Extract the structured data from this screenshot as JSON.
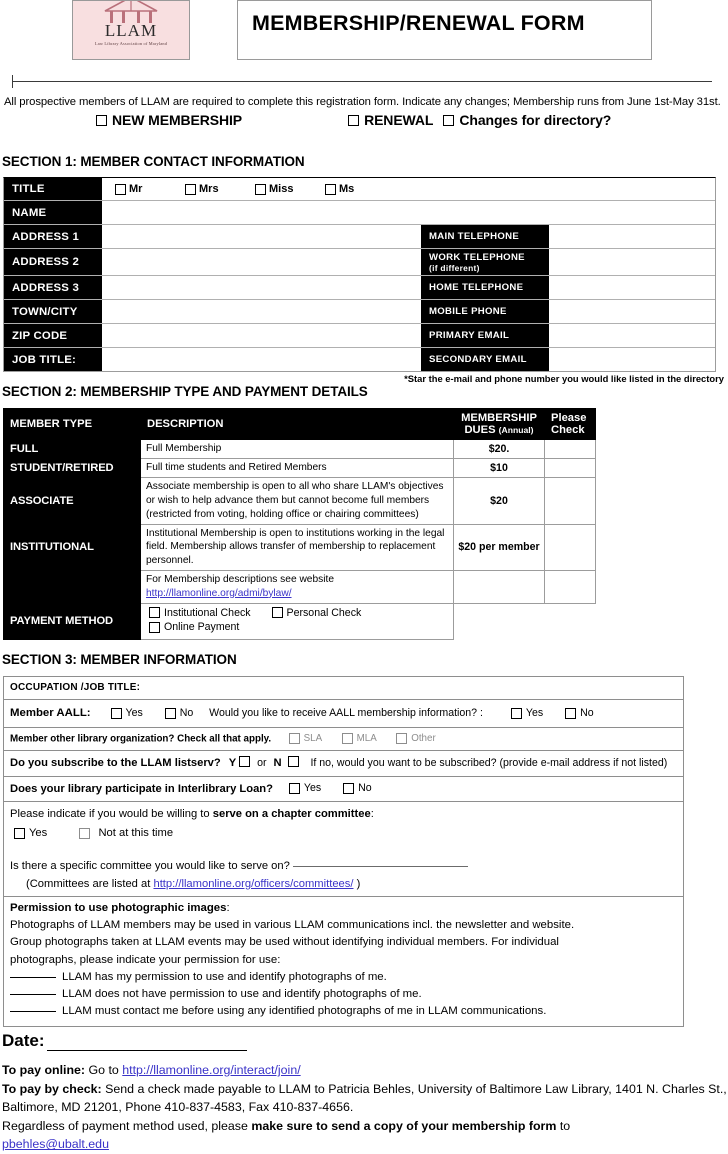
{
  "header": {
    "logo": {
      "word": "LLAM",
      "subtitle": "Law Library Association of Maryland"
    },
    "title": "MEMBERSHIP/RENEWAL FORM"
  },
  "intro": {
    "paragraph": "All prospective members of LLAM are required to complete this registration form. Indicate any changes; Membership runs from June 1st-May 31st.",
    "options": [
      "NEW MEMBERSHIP",
      "RENEWAL",
      "Changes for directory?"
    ]
  },
  "section1": {
    "heading": "SECTION 1: MEMBER CONTACT INFORMATION",
    "title_row_label": "TITLE",
    "title_options": [
      "Mr",
      "Mrs",
      "Miss",
      "Ms"
    ],
    "left_labels": [
      "NAME",
      "ADDRESS 1",
      "ADDRESS 2",
      "ADDRESS 3",
      "TOWN/CITY",
      "ZIP CODE",
      "JOB TITLE:"
    ],
    "right_labels": [
      {
        "main": "MAIN TELEPHONE",
        "sub": ""
      },
      {
        "main": "WORK TELEPHONE",
        "sub": "(if different)"
      },
      {
        "main": "HOME TELEPHONE",
        "sub": ""
      },
      {
        "main": "MOBILE PHONE",
        "sub": ""
      },
      {
        "main": "PRIMARY EMAIL",
        "sub": ""
      },
      {
        "main": "SECONDARY EMAIL",
        "sub": ""
      }
    ],
    "star_note": "*Star the e-mail and phone number you would like listed in the directory"
  },
  "section2": {
    "heading": "SECTION 2: MEMBERSHIP TYPE AND PAYMENT DETAILS",
    "columns": [
      "MEMBER TYPE",
      "DESCRIPTION",
      "MEMBERSHIP DUES",
      "(Annual)",
      "Please Check"
    ],
    "col_dues_line1": "MEMBERSHIP",
    "col_dues_line2": "DUES",
    "col_dues_annual": "(Annual)",
    "col_check_line1": "Please",
    "col_check_line2": "Check",
    "rows": [
      {
        "type": "FULL",
        "description": "Full Membership",
        "dues": "$20."
      },
      {
        "type": "STUDENT/RETIRED",
        "description": "Full time students and Retired Members",
        "dues": "$10"
      },
      {
        "type": "ASSOCIATE",
        "description": "Associate membership is open to all who share LLAM's objectives or wish to help advance them but cannot become full members (restricted from voting, holding office or chairing committees)",
        "dues": "$20"
      },
      {
        "type": "INSTITUTIONAL",
        "description": "Institutional Membership is open to institutions working in the legal field. Membership allows transfer of membership to replacement personnel.",
        "dues": "$20 per member"
      }
    ],
    "website_row": {
      "text": "For Membership descriptions see website",
      "link": "http://llamonline.org/admi/bylaw/"
    },
    "payment_method_label": "PAYMENT METHOD",
    "payment_options": [
      "Institutional Check",
      "Personal Check",
      "Online Payment"
    ]
  },
  "section3": {
    "heading": "SECTION 3: MEMBER INFORMATION",
    "occupation_label": "OCCUPATION /JOB TITLE:",
    "aall": {
      "label": "Member AALL:",
      "yes": "Yes",
      "no": "No",
      "question": "Would you like to receive AALL membership information? :",
      "q_yes": "Yes",
      "q_no": "No"
    },
    "other_org": {
      "label": "Member other library organization?  Check all that apply.",
      "options": [
        "SLA",
        "MLA",
        "Other"
      ]
    },
    "listserv": {
      "question": "Do you subscribe to the LLAM listserv?",
      "y": "Y",
      "or": "or",
      "n": "N",
      "followup": "If no, would you want to be subscribed? (provide e-mail address if not listed)"
    },
    "ill": {
      "question": "Does your library participate in Interlibrary Loan?",
      "yes": "Yes",
      "no": "No"
    },
    "committee": {
      "intro_a": "Please indicate if you would be willing to ",
      "intro_b": "serve on a chapter committee",
      "intro_c": ":",
      "yes": "Yes",
      "not_now": "Not at this time",
      "specific": "Is there a specific committee you would like to serve on?",
      "listed_at": "(Committees are listed at ",
      "link": "http://llamonline.org/officers/committees/",
      "listed_close": " )"
    },
    "permission": {
      "title": "Permission to use photographic images",
      "title_colon": ":",
      "body1": "Photographs of LLAM members may be used in various LLAM communications incl. the newsletter and website.",
      "body2": "Group photographs taken at LLAM events may be used without identifying individual members. For individual",
      "body3": "photographs, please indicate your permission for use:",
      "choices": [
        "LLAM has my permission to use and identify photographs of me.",
        "LLAM does not have permission to use and identify photographs of me.",
        "LLAM must contact me before using any identified photographs of me in LLAM communications."
      ]
    }
  },
  "date": {
    "label": "Date:"
  },
  "footer": {
    "pay_online_label": "To pay online:",
    "pay_online_text": " Go to ",
    "pay_online_link": "http://llamonline.org/interact/join/",
    "pay_check_label": "To pay by check:",
    "pay_check_text": " Send a check made payable to LLAM to Patricia Behles, University of Baltimore Law Library, 1401 N. Charles St., Baltimore, MD 21201, Phone 410-837-4583, Fax 410-837-4656.",
    "regardless_pre": "Regardless of payment method used, please ",
    "regardless_bold": "make sure to send a copy of your membership form",
    "regardless_post": " to ",
    "email": "pbehles@ubalt.edu"
  }
}
